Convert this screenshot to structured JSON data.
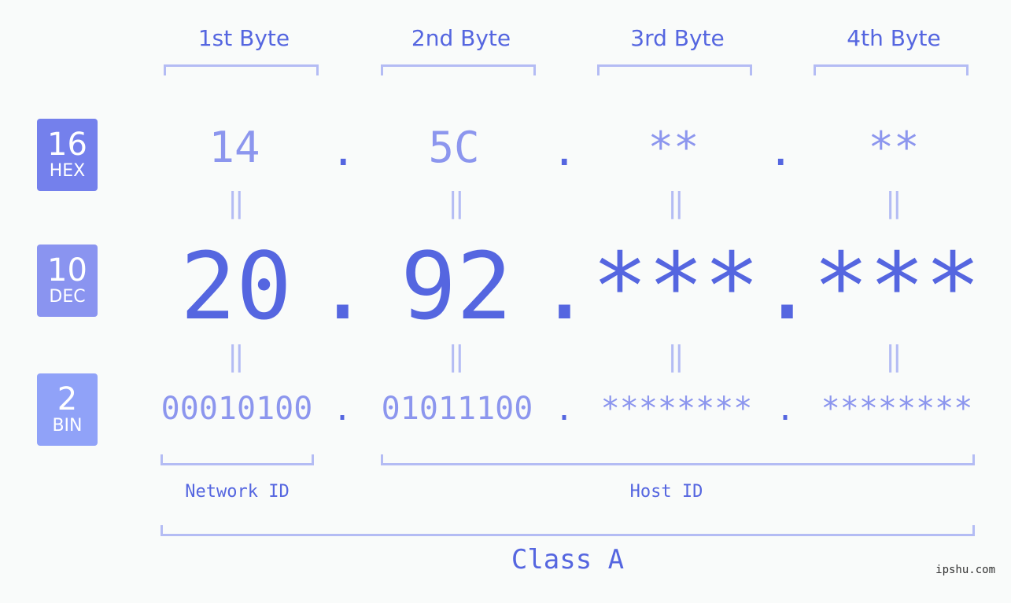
{
  "bases": [
    {
      "number": "16",
      "label": "HEX",
      "color": "#7480ec"
    },
    {
      "number": "10",
      "label": "DEC",
      "color": "#8a94f0"
    },
    {
      "number": "2",
      "label": "BIN",
      "color": "#90a2f8"
    }
  ],
  "bytes": [
    {
      "header": "1st Byte",
      "hex": "14",
      "dec": "20",
      "bin": "00010100"
    },
    {
      "header": "2nd Byte",
      "hex": "5C",
      "dec": "92",
      "bin": "01011100"
    },
    {
      "header": "3rd Byte",
      "hex": "**",
      "dec": "***",
      "bin": "********"
    },
    {
      "header": "4th Byte",
      "hex": "**",
      "dec": "***",
      "bin": "********"
    }
  ],
  "separator": ".",
  "equals": "=",
  "network_id_label": "Network ID",
  "host_id_label": "Host ID",
  "class_label": "Class A",
  "watermark": "ipshu.com"
}
